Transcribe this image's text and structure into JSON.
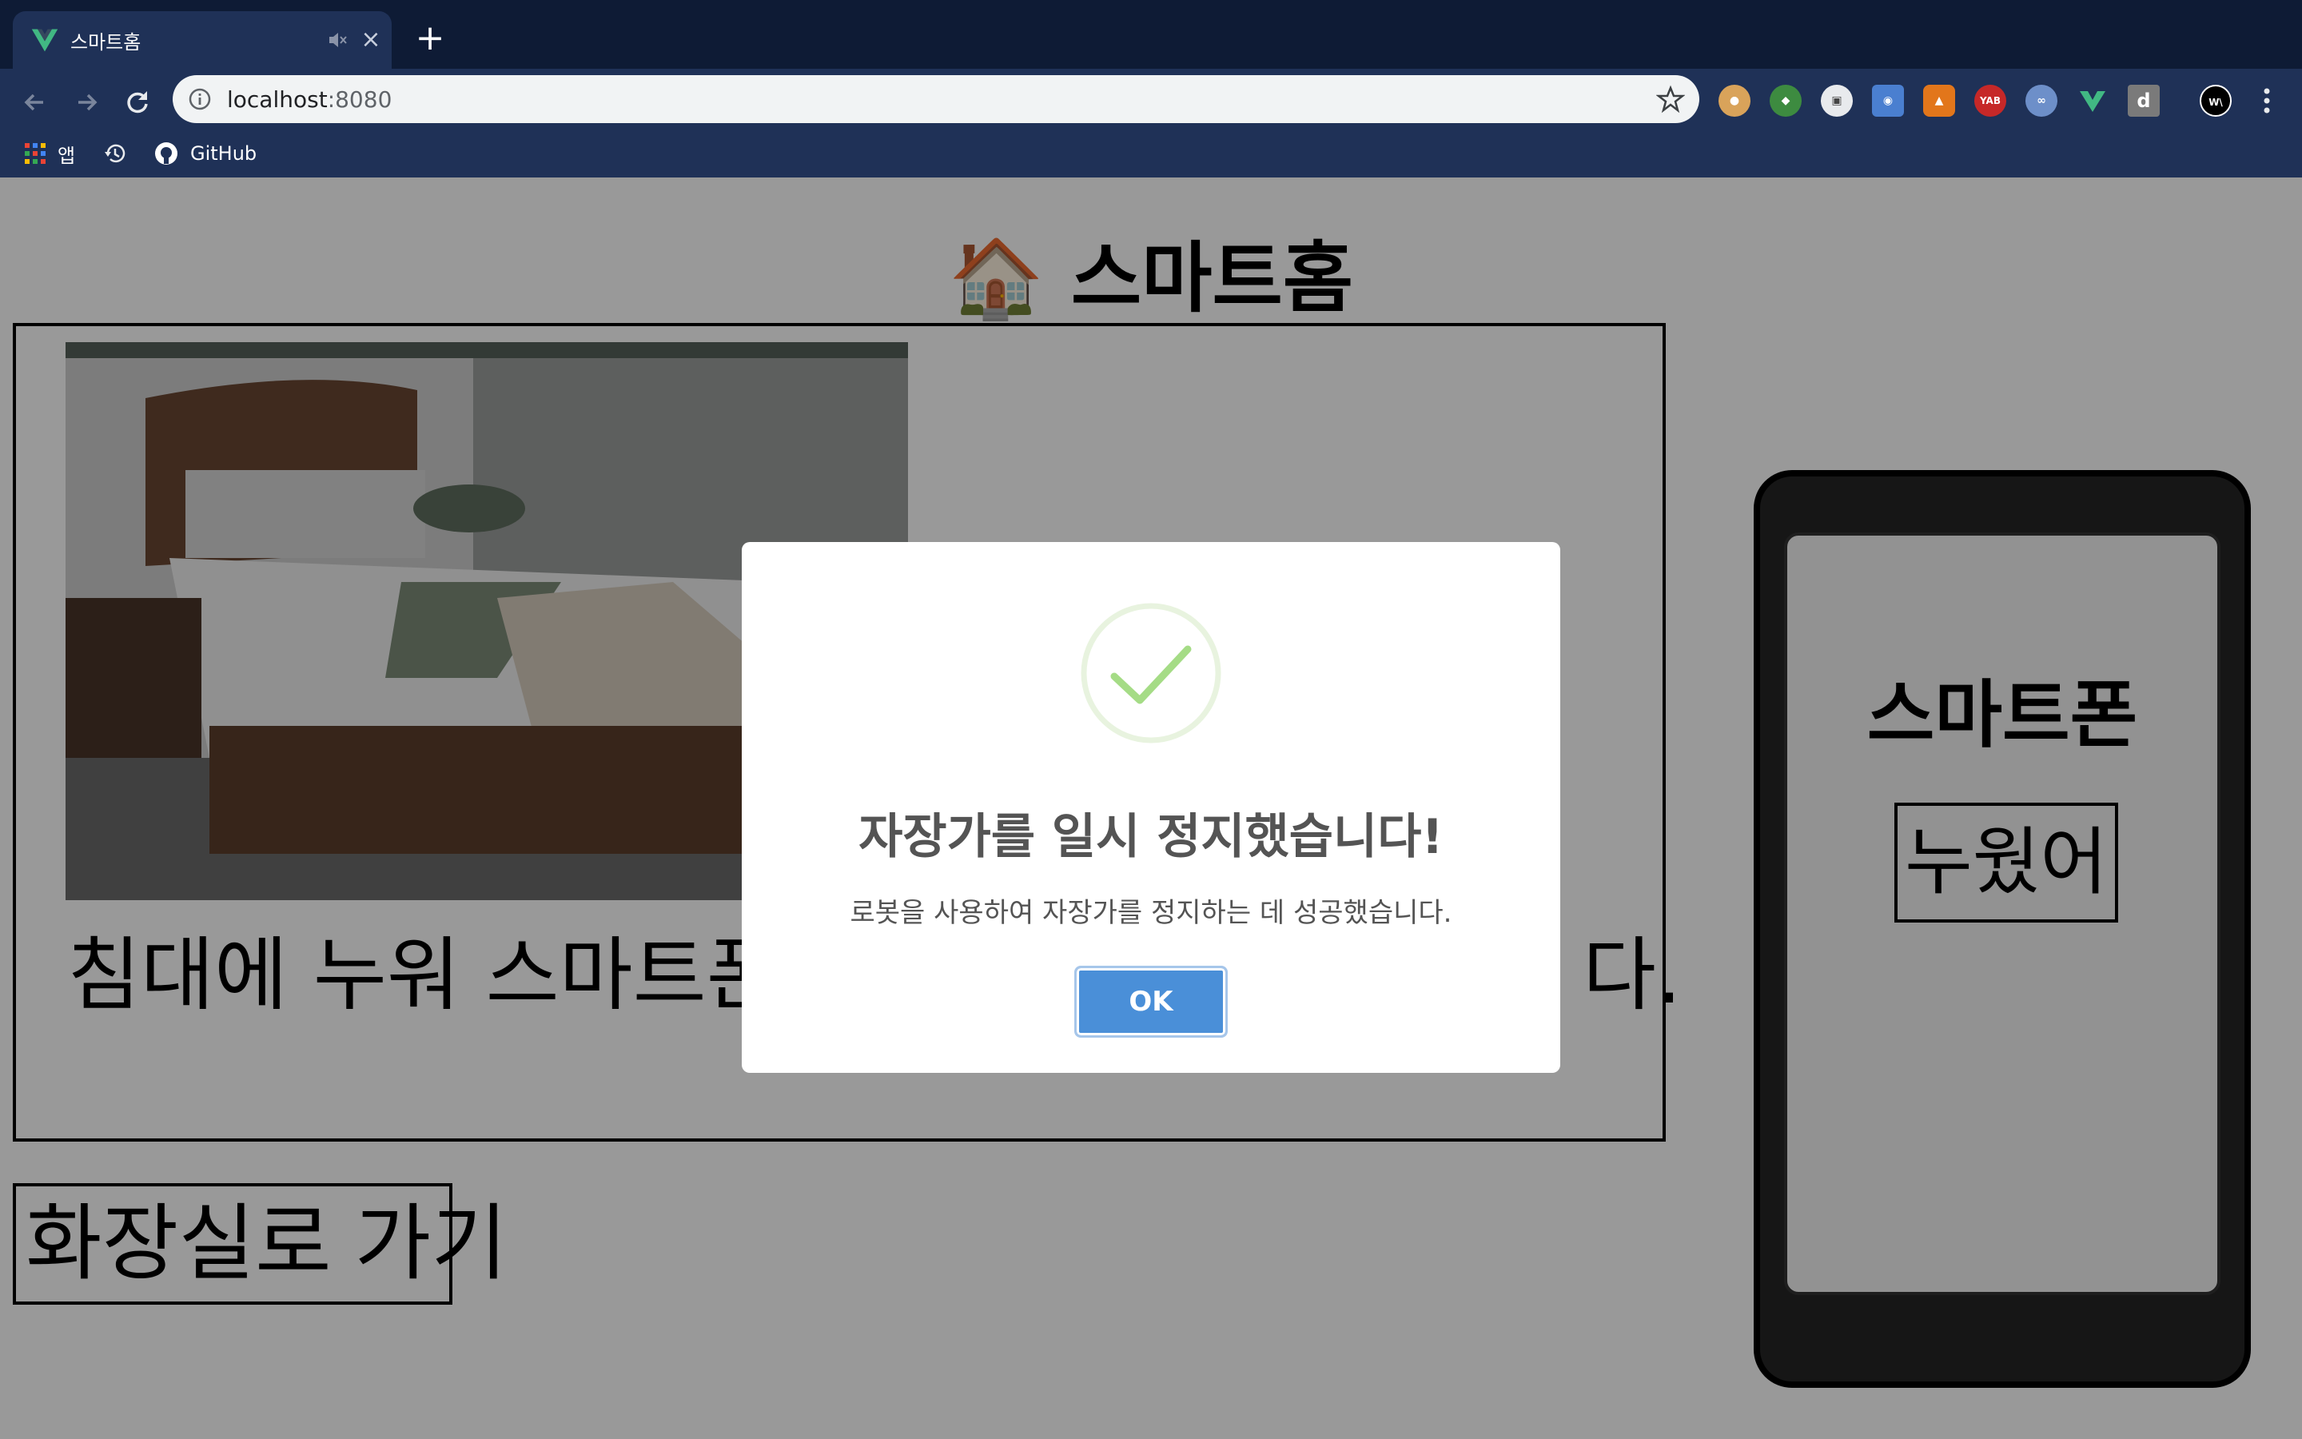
{
  "browser": {
    "tab": {
      "title": "스마트홈",
      "favicon": "vue-logo-icon",
      "mute_icon": "muted-speaker-icon",
      "close_icon": "close-icon"
    },
    "new_tab_icon": "plus-icon",
    "address_bar": {
      "host": "localhost",
      "port": ":8080"
    },
    "extensions": [
      "cookie-icon",
      "extension-icon",
      "extension-icon",
      "camera-icon",
      "metamask-fox-icon",
      "yab-icon",
      "glasses-icon",
      "vue-devtools-icon",
      "d-icon",
      "profile-avatar-icon"
    ],
    "bookmarks": [
      {
        "label": "앱",
        "icon": "apps-grid-icon"
      },
      {
        "label": "",
        "icon": "history-icon"
      },
      {
        "label": "GitHub",
        "icon": "github-icon"
      }
    ],
    "colors": {
      "tabstrip": "#0e1b35",
      "toolbar": "#1f3157"
    }
  },
  "page": {
    "title_emoji": "🏠",
    "title": "스마트홈",
    "room": {
      "photo": "bedroom-photo",
      "caption_start": "침대에 누워 스마트폰",
      "caption_end": "다."
    },
    "go_button": "화장실로 가기",
    "phone": {
      "title": "스마트폰",
      "button": "누웠어"
    }
  },
  "modal": {
    "icon": "success-check-icon",
    "title": "자장가를 일시 정지했습니다!",
    "text": "로봇을 사용하여 자장가를 정지하는 데 성공했습니다.",
    "ok_button": "OK",
    "colors": {
      "ok_button": "#4a8fd8",
      "check": "#a5dc86"
    }
  }
}
